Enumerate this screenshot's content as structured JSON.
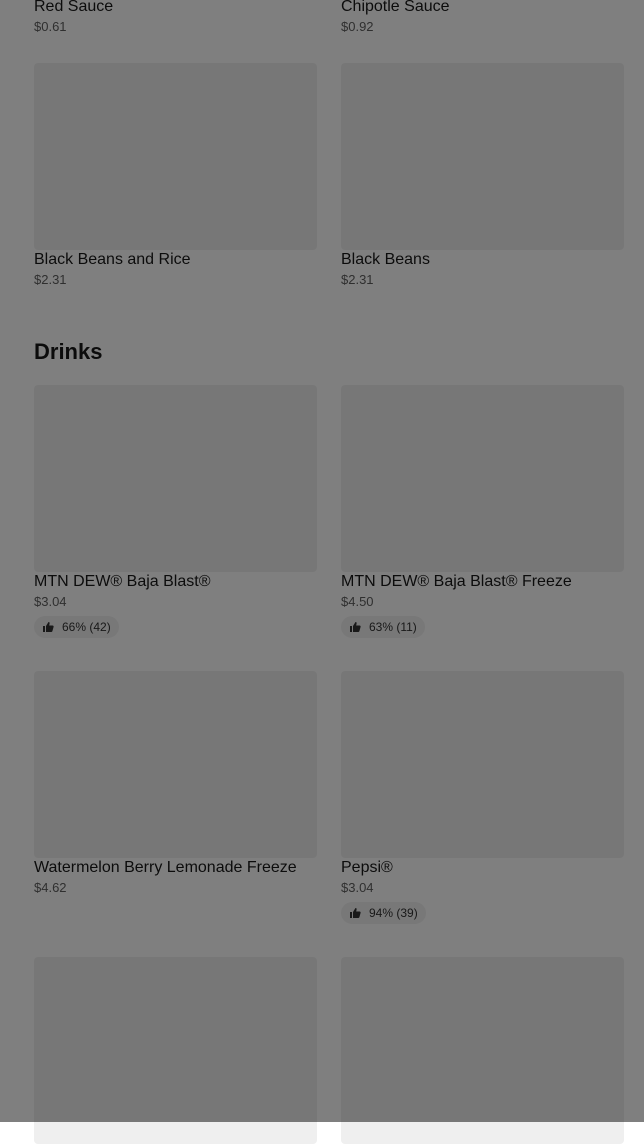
{
  "sauces": [
    {
      "name": "Red Sauce",
      "price": "$0.61"
    },
    {
      "name": "Chipotle Sauce",
      "price": "$0.92"
    },
    {
      "name": "Black Beans and Rice",
      "price": "$2.31"
    },
    {
      "name": "Black Beans",
      "price": "$2.31"
    }
  ],
  "drinks": {
    "title": "Drinks",
    "items": [
      {
        "name": "MTN DEW® Baja Blast®",
        "price": "$3.04",
        "rating": "66% (42)"
      },
      {
        "name": "MTN DEW® Baja Blast® Freeze",
        "price": "$4.50",
        "rating": "63% (11)"
      },
      {
        "name": "Watermelon Berry Lemonade Freeze",
        "price": "$4.62"
      },
      {
        "name": "Pepsi®",
        "price": "$3.04",
        "rating": "94% (39)"
      }
    ]
  },
  "icons": {
    "rating": "thumbs-up-icon"
  },
  "colors": {
    "overlay": "rgba(0,0,0,0.5)",
    "image_placeholder": "#efefef"
  }
}
